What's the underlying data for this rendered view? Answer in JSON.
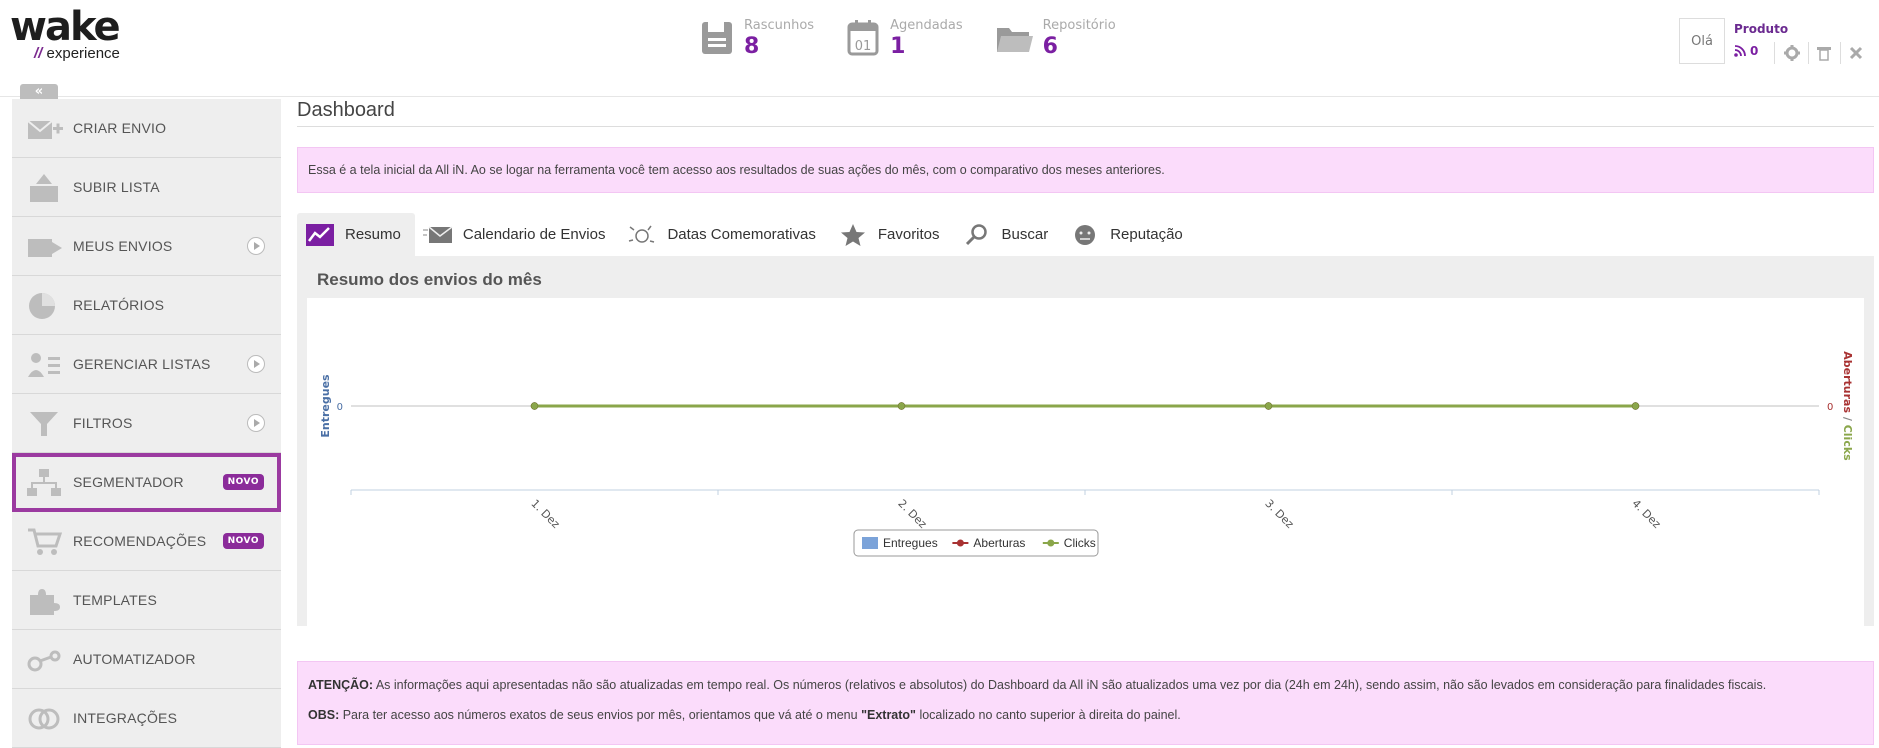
{
  "logo": {
    "main": "wake",
    "sub_prefix": "//",
    "sub": " experience"
  },
  "stats": [
    {
      "label": "Rascunhos",
      "value": "8",
      "icon": "floppy-disk-icon"
    },
    {
      "label": "Agendadas",
      "value": "1",
      "icon": "calendar-icon"
    },
    {
      "label": "Repositório",
      "value": "6",
      "icon": "folder-icon"
    }
  ],
  "user": {
    "greeting": "Olá",
    "name": "Produto",
    "feed_count": "0"
  },
  "collapse_label": "«",
  "sidebar": {
    "items": [
      {
        "label": "CRIAR ENVIO",
        "icon": "create-mail-icon"
      },
      {
        "label": "SUBIR LISTA",
        "icon": "upload-list-icon"
      },
      {
        "label": "MEUS ENVIOS",
        "icon": "my-sends-icon"
      },
      {
        "label": "RELATÓRIOS",
        "icon": "pie-chart-icon"
      },
      {
        "label": "GERENCIAR LISTAS",
        "icon": "manage-lists-icon"
      },
      {
        "label": "FILTROS",
        "icon": "funnel-icon"
      },
      {
        "label": "SEGMENTADOR",
        "icon": "segment-tree-icon",
        "badge": "NOVO"
      },
      {
        "label": "RECOMENDAÇÕES",
        "icon": "cart-icon",
        "badge": "NOVO"
      },
      {
        "label": "TEMPLATES",
        "icon": "puzzle-icon"
      },
      {
        "label": "AUTOMATIZADOR",
        "icon": "automation-icon"
      },
      {
        "label": "INTEGRAÇÕES",
        "icon": "integration-icon"
      }
    ]
  },
  "main": {
    "title": "Dashboard",
    "info": "Essa é a tela inicial da All iN. Ao se logar na ferramenta você tem acesso aos resultados de suas ações do mês, com o comparativo dos meses anteriores.",
    "tabs": [
      {
        "label": "Resumo",
        "icon": "trend-icon"
      },
      {
        "label": "Calendario de Envios",
        "icon": "envelope-icon"
      },
      {
        "label": "Datas Comemorativas",
        "icon": "confetti-icon"
      },
      {
        "label": "Favoritos",
        "icon": "star-icon"
      },
      {
        "label": "Buscar",
        "icon": "search-icon"
      },
      {
        "label": "Reputação",
        "icon": "reputation-icon"
      }
    ],
    "panel_title": "Resumo dos envios do mês",
    "notice": {
      "attention_label": "ATENÇÃO:",
      "attention_text": " As informações aqui apresentadas não são atualizadas em tempo real. Os números (relativos e absolutos) do Dashboard da All iN são atualizados uma vez por dia (24h em 24h), sendo assim, não são levados em consideração para finalidades fiscais.",
      "obs_label": "OBS:",
      "obs_text_before": " Para ter acesso aos números exatos de seus envios por mês, orientamos que vá até o menu ",
      "obs_highlight": "\"Extrato\"",
      "obs_text_after": " localizado no canto superior à direita do painel."
    }
  },
  "chart_data": {
    "type": "line",
    "categories": [
      "1. Dez",
      "2. Dez",
      "3. Dez",
      "4. Dez"
    ],
    "series": [
      {
        "name": "Entregues",
        "values": [
          0,
          0,
          0,
          0
        ],
        "color": "#7ba3d9"
      },
      {
        "name": "Aberturas",
        "values": [
          0,
          0,
          0,
          0
        ],
        "color": "#a83232"
      },
      {
        "name": "Clicks",
        "values": [
          0,
          0,
          0,
          0
        ],
        "color": "#8aa64a"
      }
    ],
    "ylabel_left": "Entregues",
    "ylabel_right_a": "Aberturas",
    "ylabel_right_sep": "/",
    "ylabel_right_b": "Clicks",
    "yticks_left": [
      "0"
    ],
    "yticks_right": [
      "0"
    ],
    "legend": "bottom-center"
  },
  "colors": {
    "accent": "#7b1fa2",
    "badge": "#8b2b9a",
    "info_bg": "#fbdcfb",
    "sidebar_bg": "#eeeeee"
  }
}
